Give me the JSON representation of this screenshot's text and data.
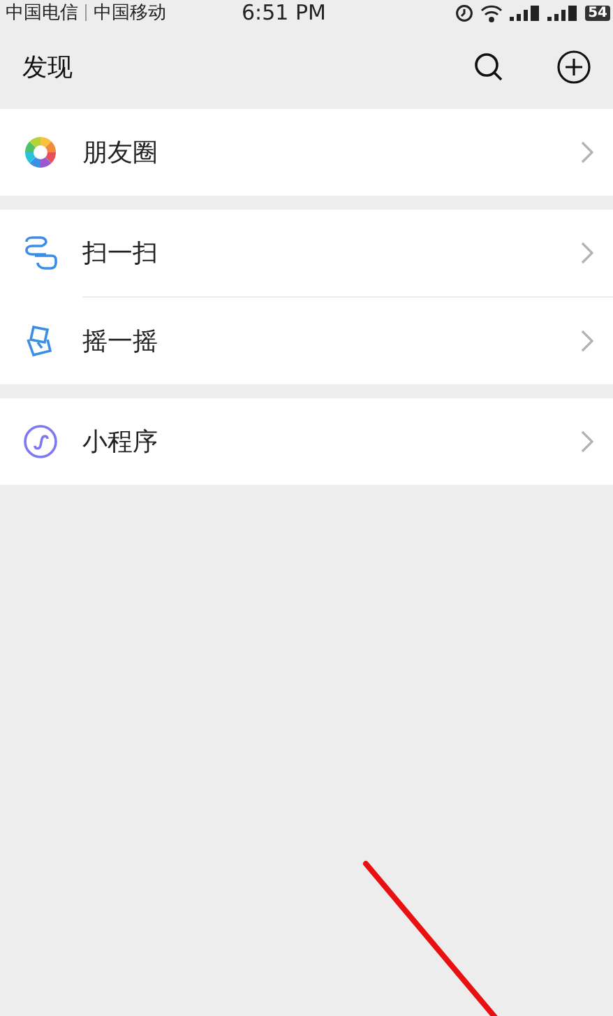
{
  "status_bar": {
    "carriers": [
      "中国电信",
      "中国移动"
    ],
    "time": "6:51 PM",
    "battery": "54"
  },
  "header": {
    "title": "发现"
  },
  "groups": [
    {
      "items": [
        {
          "kind": "moments",
          "label": "朋友圈"
        }
      ]
    },
    {
      "items": [
        {
          "kind": "scan",
          "label": "扫一扫"
        },
        {
          "kind": "shake",
          "label": "摇一摇"
        }
      ]
    },
    {
      "items": [
        {
          "kind": "miniprogram",
          "label": "小程序"
        }
      ]
    }
  ]
}
